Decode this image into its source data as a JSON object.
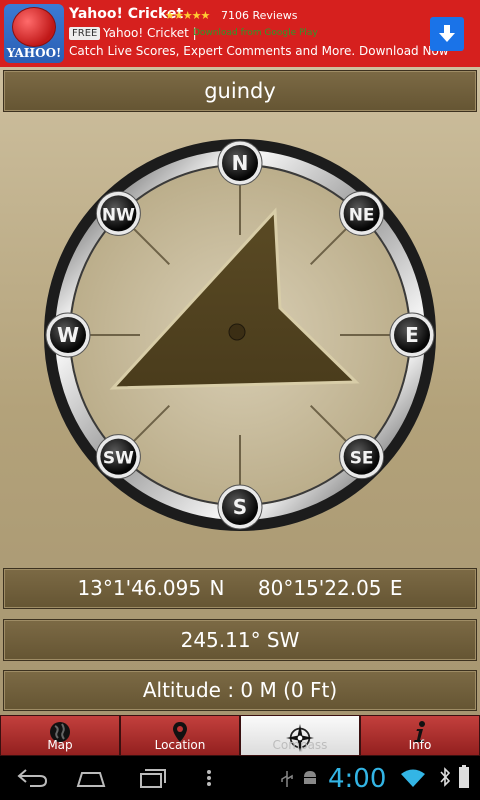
{
  "ad": {
    "logo_text": "YAHOO!",
    "title": "Yahoo! Cricket",
    "stars": "★★★★★",
    "rating": 4.5,
    "reviews": "7106 Reviews",
    "free_badge": "FREE",
    "app_name": "Yahoo! Cricket |",
    "google_play": "Download from Google Play",
    "description": "Catch Live Scores, Expert Comments and More. Download Now"
  },
  "location_name": "guindy",
  "compass": {
    "directions": [
      "N",
      "NE",
      "E",
      "SE",
      "S",
      "SW",
      "W",
      "NW"
    ],
    "heading_deg": 245.11
  },
  "coords": {
    "lat": "13°1'46.095 N",
    "lon": "80°15'22.05 E"
  },
  "heading_text": "245.11° SW",
  "altitude_text": "Altitude : 0 M (0  Ft)",
  "tabs": [
    {
      "label": "Map",
      "icon": "globe-icon",
      "active": false
    },
    {
      "label": "Location",
      "icon": "map-pin-icon",
      "active": false
    },
    {
      "label": "Compass",
      "icon": "compass-rose-icon",
      "active": true
    },
    {
      "label": "Info",
      "icon": "info-icon",
      "active": false
    }
  ],
  "status": {
    "time": "4:00"
  },
  "colors": {
    "ad_red": "#d6201e",
    "panel_brown": "#6f5f3c",
    "clock_blue": "#33b5e5"
  }
}
